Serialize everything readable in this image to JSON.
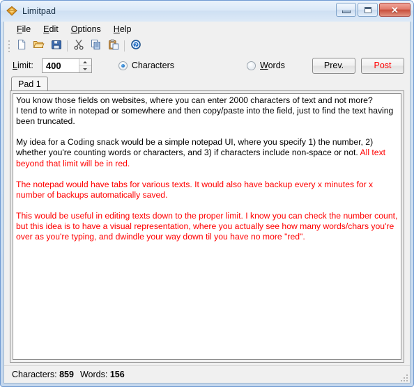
{
  "window": {
    "title": "Limitpad",
    "app_icon": "diamond-icon",
    "accent_color": "#ff0000",
    "caption": {
      "minimize_label": "Minimize",
      "maximize_label": "Maximize",
      "close_label": "Close"
    }
  },
  "menubar": {
    "items": [
      {
        "label": "File",
        "accel": "F"
      },
      {
        "label": "Edit",
        "accel": "E"
      },
      {
        "label": "Options",
        "accel": "O"
      },
      {
        "label": "Help",
        "accel": "H"
      }
    ]
  },
  "toolbar": {
    "buttons": [
      {
        "name": "new-icon",
        "label": "New"
      },
      {
        "name": "open-icon",
        "label": "Open"
      },
      {
        "name": "save-icon",
        "label": "Save"
      },
      {
        "name": "cut-icon",
        "label": "Cut"
      },
      {
        "name": "copy-icon",
        "label": "Copy"
      },
      {
        "name": "paste-icon",
        "label": "Paste"
      },
      {
        "name": "help-icon",
        "label": "Help"
      }
    ]
  },
  "options": {
    "limit_label": "Limit:",
    "limit_accel": "L",
    "limit_value": "400",
    "mode_characters": {
      "label": "Characters",
      "selected": true,
      "accel": ""
    },
    "mode_words": {
      "label": "Words",
      "selected": false,
      "accel": "W"
    },
    "prev_button": "Prev.",
    "post_button": "Post"
  },
  "tabs": [
    {
      "label": "Pad 1",
      "active": true
    }
  ],
  "editor": {
    "within_limit_text": "You know those fields on websites, where you can enter 2000 characters of text and not more?\nI tend to write in notepad or somewhere and then copy/paste into the field, just to find the text having been truncated.\n\nMy idea for a Coding snack would be a simple notepad UI, where you specify 1) the number, 2) whether you're counting words or characters, and 3) if characters include non-space or not. ",
    "over_limit_text": "All text beyond that limit will be in red.\n\nThe notepad would have tabs for various texts. It would also have backup every x minutes for x number of backups automatically saved.\n\nThis would be useful in editing texts down to the proper limit. I know you can check the number count, but this idea is to have a visual representation, where you actually see how many words/chars you're over as you're typing, and dwindle your way down til you have no more \"red\"."
  },
  "statusbar": {
    "characters_label": "Characters:",
    "characters_value": "859",
    "words_label": "Words:",
    "words_value": "156"
  }
}
